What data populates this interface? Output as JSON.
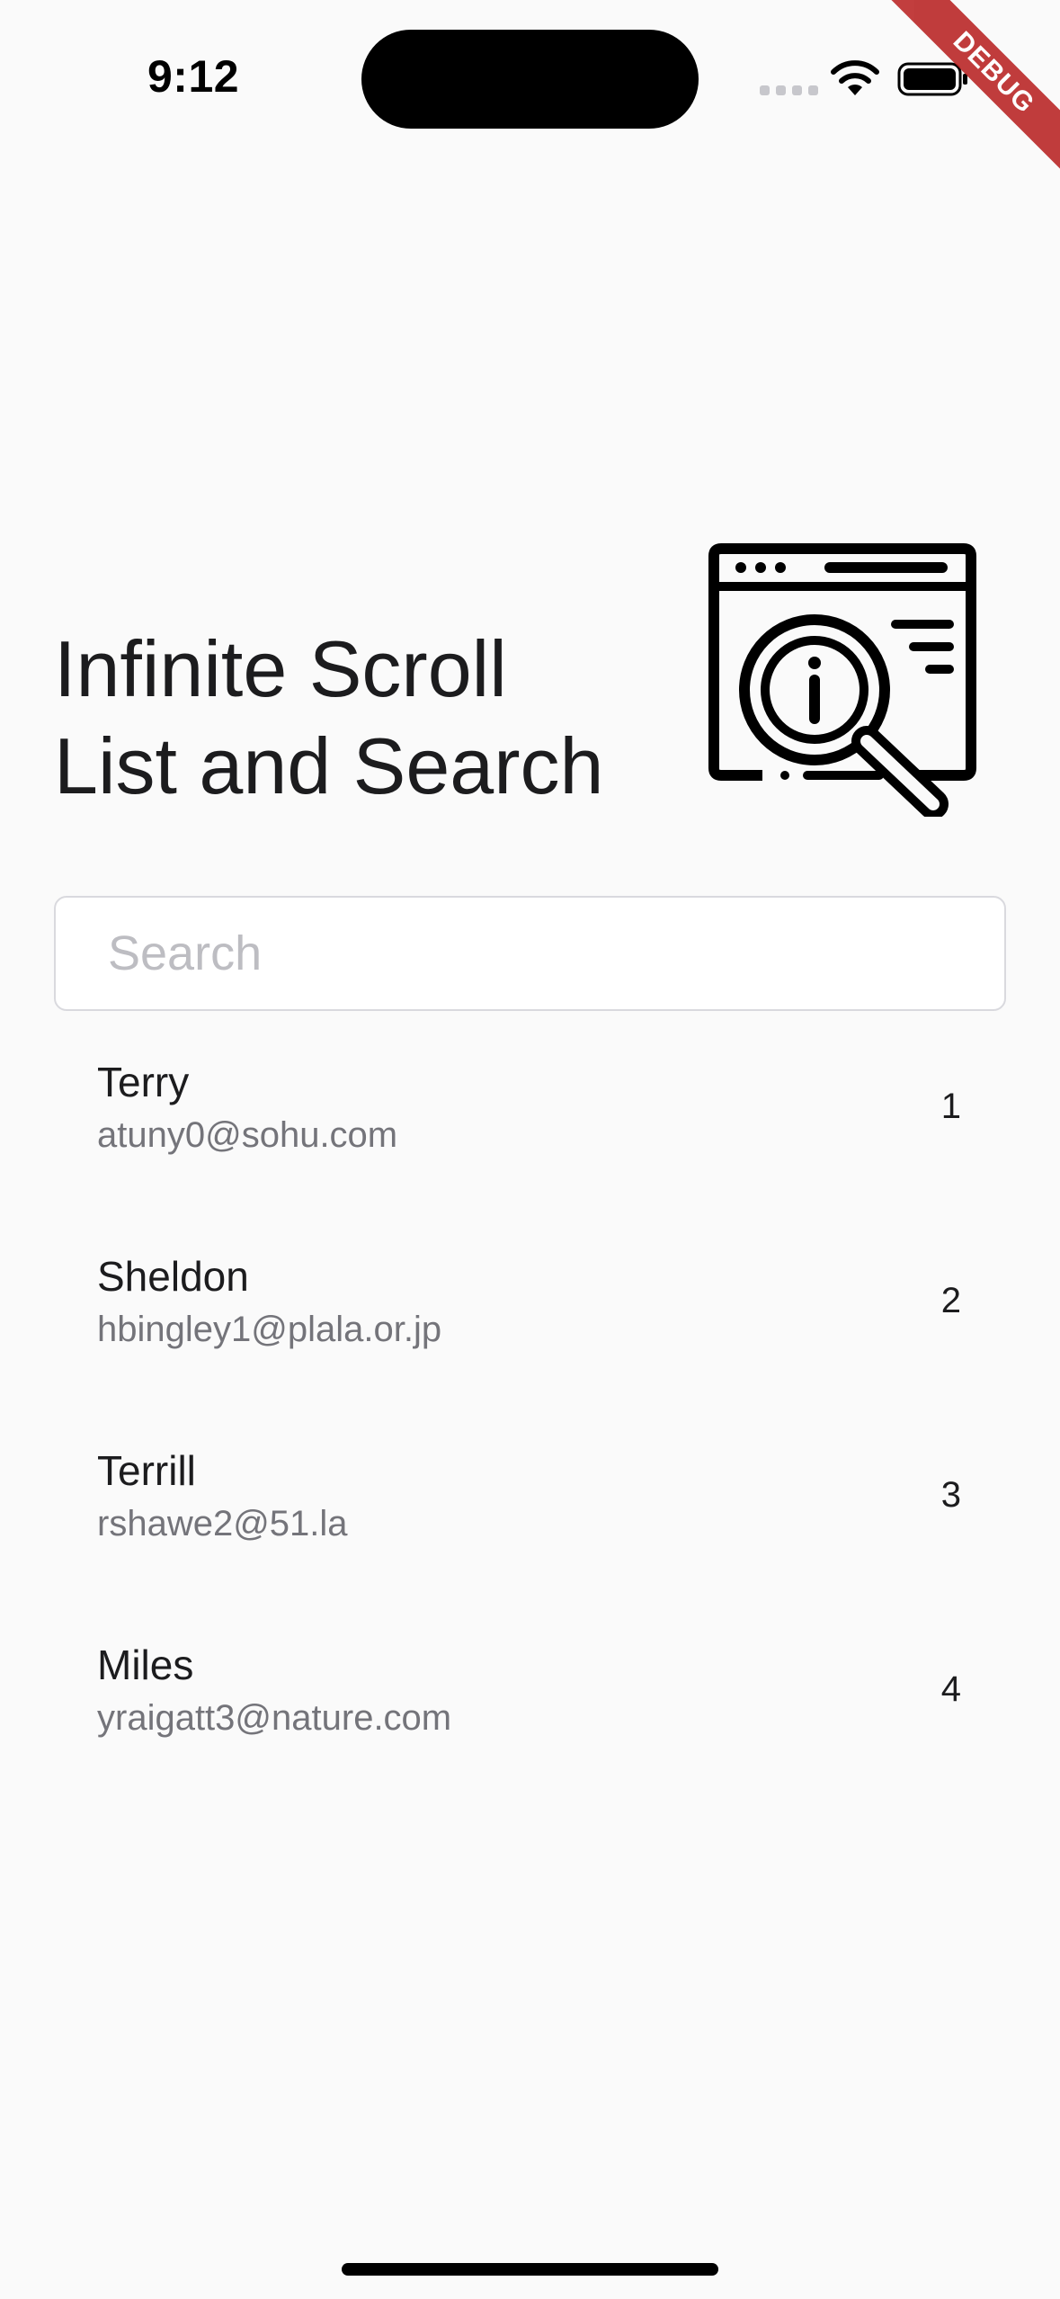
{
  "status_bar": {
    "time": "9:12",
    "icons": [
      "cellular-signal-icon",
      "wifi-icon",
      "battery-icon"
    ]
  },
  "debug_banner": {
    "label": "DEBUG",
    "color": "#b71c1c"
  },
  "header": {
    "title_line1": "Infinite Scroll",
    "title_line2": "List and Search",
    "illustration_icon": "browser-magnifier-info-icon"
  },
  "search": {
    "placeholder": "Search",
    "value": ""
  },
  "list": {
    "items": [
      {
        "name": "Terry",
        "email": "atuny0@sohu.com",
        "number": "1"
      },
      {
        "name": "Sheldon",
        "email": "hbingley1@plala.or.jp",
        "number": "2"
      },
      {
        "name": "Terrill",
        "email": "rshawe2@51.la",
        "number": "3"
      },
      {
        "name": "Miles",
        "email": "yraigatt3@nature.com",
        "number": "4"
      }
    ]
  },
  "colors": {
    "background": "#fafafa",
    "text_primary": "#1c1c1e",
    "text_secondary": "#74747a",
    "placeholder": "#bdbdc2"
  }
}
